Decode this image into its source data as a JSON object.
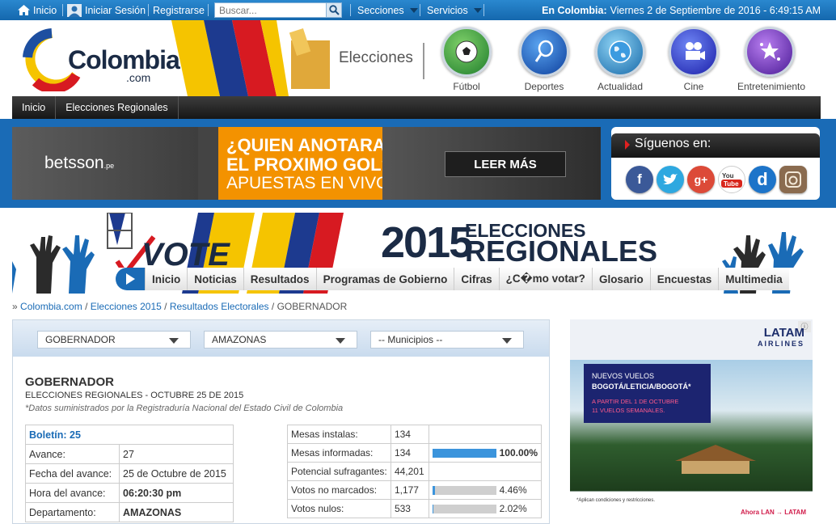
{
  "topbar": {
    "inicio": "Inicio",
    "login": "Iniciar Sesión",
    "register": "Registrarse",
    "search_placeholder": "Buscar...",
    "secciones": "Secciones",
    "servicios": "Servicios",
    "location_label": "En Colombia:",
    "datetime": "Viernes 2 de Septiembre de 2016 - 6:49:15 AM"
  },
  "header": {
    "logo_text": "Colombia",
    "logo_sub": ".com",
    "elecciones_label": "Elecciones",
    "categories": [
      {
        "label": "Fútbol",
        "icon": "soccer-ball-icon"
      },
      {
        "label": "Deportes",
        "icon": "tennis-icon"
      },
      {
        "label": "Actualidad",
        "icon": "globe-icon"
      },
      {
        "label": "Cine",
        "icon": "film-camera-icon"
      },
      {
        "label": "Entretenimiento",
        "icon": "stars-icon"
      }
    ]
  },
  "darknav": {
    "items": [
      "Inicio",
      "Elecciones Regionales"
    ]
  },
  "ad_betsson": {
    "brand": "betsson",
    "brand_suffix": ".pe",
    "line1": "¿QUIEN ANOTARA",
    "line2": "EL PROXIMO GOL?",
    "line3": "APUESTAS EN VIVO",
    "cta": "LEER MÁS"
  },
  "social": {
    "title": "Síguenos en:",
    "networks": [
      "facebook",
      "twitter",
      "google-plus",
      "youtube",
      "dailymotion",
      "instagram"
    ]
  },
  "regional_banner": {
    "vote": "VOTE",
    "year": "2015",
    "title1": "ELECCIONES",
    "title2": "REGIONALES",
    "nav": [
      "Inicio",
      "Noticias",
      "Resultados",
      "Programas de Gobierno",
      "Cifras",
      "¿C�mo votar?",
      "Glosario",
      "Encuestas",
      "Multimedia"
    ]
  },
  "breadcrumb": {
    "prefix": "»",
    "items": [
      "Colombia.com",
      "Elecciones 2015",
      "Resultados Electorales"
    ],
    "current": "GOBERNADOR"
  },
  "filters": {
    "cargo": "GOBERNADOR",
    "departamento": "AMAZONAS",
    "municipio": "-- Municipios --"
  },
  "results": {
    "title": "GOBERNADOR",
    "subtitle": "ELECCIONES REGIONALES - OCTUBRE 25 DE 2015",
    "note": "*Datos suministrados por la Registraduría Nacional del Estado Civil de Colombia",
    "boletin": "Boletín: 25",
    "left_rows": [
      {
        "label": "Avance:",
        "value": "27"
      },
      {
        "label": "Fecha del avance:",
        "value": "25 de Octubre de 2015"
      },
      {
        "label": "Hora del avance:",
        "value": "06:20:30 pm"
      },
      {
        "label": "Departamento:",
        "value": "AMAZONAS"
      }
    ],
    "right_rows": [
      {
        "label": "Mesas instalas:",
        "value": "134",
        "pct": null,
        "pct_text": ""
      },
      {
        "label": "Mesas informadas:",
        "value": "134",
        "pct": 100.0,
        "pct_text": "100.00%"
      },
      {
        "label": "Potencial sufragantes:",
        "value": "44,201",
        "pct": null,
        "pct_text": ""
      },
      {
        "label": "Votos no marcados:",
        "value": "1,177",
        "pct": 4.46,
        "pct_text": "4.46%"
      },
      {
        "label": "Votos nulos:",
        "value": "533",
        "pct": 2.02,
        "pct_text": "2.02%"
      }
    ]
  },
  "ad_latam": {
    "brand": "LATAM",
    "brand_sub": "AIRLINES",
    "l1": "NUEVOS VUELOS",
    "l2": "BOGOTÁ/LETICIA/BOGOTÁ*",
    "l3": "A PARTIR DEL 1 DE OCTUBRE",
    "l4": "11 VUELOS SEMANALES.",
    "cond": "*Aplican condiciones y restricciones.",
    "ahora": "Ahora LAN → LATAM"
  },
  "colors": {
    "primary_blue": "#1a6bb6",
    "dark": "#1b2b45",
    "orange": "#f39200"
  }
}
